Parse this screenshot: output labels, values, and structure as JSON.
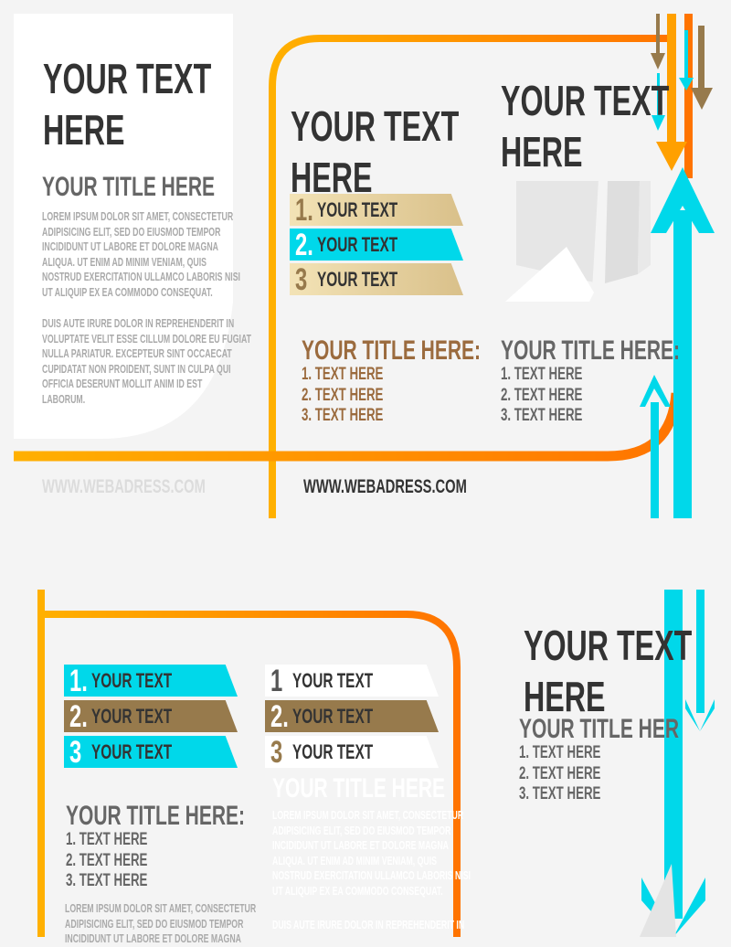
{
  "colors": {
    "cyan": "#00d8ea",
    "orange": "#ff7a00",
    "yellow": "#ffb000",
    "brown": "#977a4c",
    "title_brown": "#9b6b3e",
    "dark": "#333333",
    "gray": "#666666"
  },
  "top": {
    "left_panel": {
      "headline": [
        "YOUR TEXT",
        "HERE"
      ],
      "title": "YOUR TITLE HERE",
      "paragraph1": [
        "LOREM IPSUM DOLOR SIT AMET, CONSECTETUR",
        "ADIPISICING ELIT, SED DO EIUSMOD TEMPOR",
        "INCIDIDUNT UT LABORE ET DOLORE MAGNA",
        "ALIQUA. UT ENIM AD MINIM VENIAM, QUIS",
        "NOSTRUD EXERCITATION ULLAMCO LABORIS NISI",
        "UT ALIQUIP EX EA COMMODO CONSEQUAT."
      ],
      "paragraph2": [
        "DUIS AUTE IRURE DOLOR IN REPREHENDERIT IN",
        "VOLUPTATE VELIT ESSE CILLUM DOLORE EU FUGIAT",
        "NULLA PARIATUR. EXCEPTEUR SINT OCCAECAT",
        "CUPIDATAT NON PROIDENT, SUNT IN CULPA QUI",
        "OFFICIA DESERUNT MOLLIT ANIM ID EST",
        "LABORUM."
      ],
      "web": "WWW.WEBADRESS.COM"
    },
    "middle": {
      "headline": [
        "YOUR TEXT",
        "HERE"
      ],
      "banners": [
        {
          "num": "1.",
          "text": "YOUR TEXT",
          "style": "gold"
        },
        {
          "num": "2.",
          "text": "YOUR TEXT",
          "style": "cyan"
        },
        {
          "num": "3",
          "text": "YOUR TEXT",
          "style": "gold"
        }
      ],
      "title": "YOUR TITLE HERE:",
      "items": [
        "1. TEXT HERE",
        "2. TEXT HERE",
        "3. TEXT HERE"
      ],
      "web": "WWW.WEBADRESS.COM"
    },
    "right": {
      "headline": [
        "YOUR TEXT",
        "HERE"
      ],
      "title": "YOUR TITLE HERE:",
      "items": [
        "1. TEXT HERE",
        "2. TEXT HERE",
        "3. TEXT HERE"
      ]
    }
  },
  "bottom": {
    "left": {
      "banners": [
        {
          "num": "1.",
          "text": "YOUR TEXT",
          "style": "cyan"
        },
        {
          "num": "2.",
          "text": "YOUR TEXT",
          "style": "brown"
        },
        {
          "num": "3",
          "text": "YOUR TEXT",
          "style": "cyan"
        }
      ],
      "title": "YOUR TITLE HERE:",
      "items": [
        "1. TEXT HERE",
        "2. TEXT HERE",
        "3. TEXT HERE"
      ],
      "paragraph": [
        "LOREM IPSUM DOLOR SIT AMET, CONSECTETUR",
        "ADIPISICING ELIT, SED DO EIUSMOD TEMPOR",
        "INCIDIDUNT UT LABORE ET DOLORE MAGNA"
      ]
    },
    "middle": {
      "banners": [
        {
          "num": "1",
          "text": "YOUR TEXT",
          "style": "white"
        },
        {
          "num": "2.",
          "text": "YOUR TEXT",
          "style": "brown"
        },
        {
          "num": "3",
          "text": "YOUR TEXT",
          "style": "white"
        }
      ],
      "title": "YOUR TITLE HERE",
      "paragraph1": [
        "LOREM IPSUM DOLOR SIT AMET, CONSECTETUR",
        "ADIPISICING ELIT, SED DO EIUSMOD TEMPOR",
        "INCIDIDUNT UT LABORE ET DOLORE MAGNA",
        "ALIQUA. UT ENIM AD MINIM VENIAM, QUIS",
        "NOSTRUD EXERCITATION ULLAMCO LABORIS NISI",
        "UT ALIQUIP EX EA COMMODO CONSEQUAT."
      ],
      "paragraph2": [
        "DUIS AUTE IRURE DOLOR IN REPREHENDERIT IN"
      ]
    },
    "right": {
      "headline": [
        "YOUR TEXT",
        "HERE"
      ],
      "title": "YOUR TITLE HER",
      "items": [
        "1. TEXT HERE",
        "2. TEXT HERE",
        "3. TEXT HERE"
      ]
    }
  }
}
